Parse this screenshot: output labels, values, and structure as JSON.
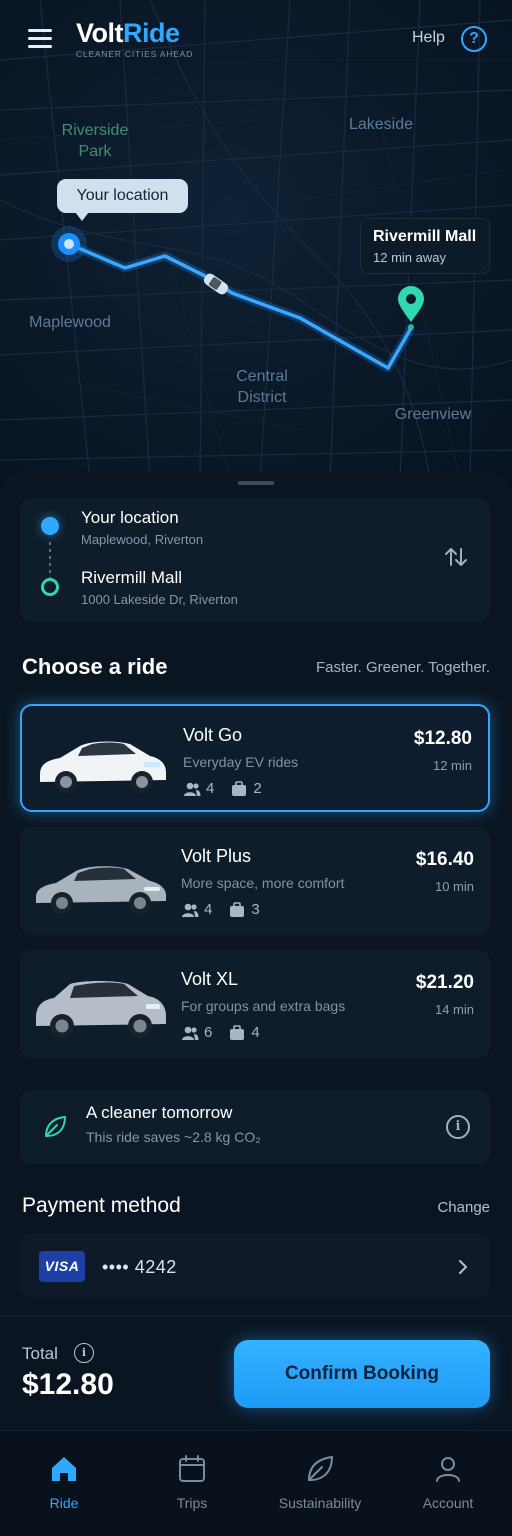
{
  "app": {
    "logo_primary": "Volt",
    "logo_accent": "Ride",
    "tagline": "CLEANER CITIES AHEAD",
    "help_label": "Help",
    "accent_color": "#2fa8ff",
    "eco_color": "#2fd7b3"
  },
  "map": {
    "labels": {
      "riverside_park": "Riverside\nPark",
      "lakeside": "Lakeside",
      "maplewood": "Maplewood",
      "central_district": "Central\nDistrict",
      "greenview": "Greenview"
    },
    "origin_bubble": "Your location",
    "destination_tooltip": {
      "title": "Rivermill Mall",
      "eta": "12 min away"
    }
  },
  "route": {
    "origin": {
      "title": "Your location",
      "address": "Maplewood, Riverton"
    },
    "destination": {
      "title": "Rivermill Mall",
      "address": "1000 Lakeside Dr, Riverton"
    }
  },
  "rides_section": {
    "title": "Choose a ride",
    "slogan": "Faster. Greener. Together.",
    "options": [
      {
        "name": "Volt Go",
        "description": "Everyday EV rides",
        "passengers": "4",
        "bags": "2",
        "price": "$12.80",
        "eta": "12 min",
        "car_color": "white",
        "selected": true
      },
      {
        "name": "Volt Plus",
        "description": "More space, more comfort",
        "passengers": "4",
        "bags": "3",
        "price": "$16.40",
        "eta": "10 min",
        "car_color": "silver",
        "selected": false
      },
      {
        "name": "Volt XL",
        "description": "For groups and extra bags",
        "passengers": "6",
        "bags": "4",
        "price": "$21.20",
        "eta": "14 min",
        "car_color": "silver-suv",
        "selected": false
      }
    ]
  },
  "eco": {
    "title": "A cleaner tomorrow",
    "subtitle": "This ride saves ~2.8 kg CO₂",
    "icon": "leaf-icon"
  },
  "payment": {
    "title": "Payment method",
    "change_label": "Change",
    "card_brand": "VISA",
    "card_masked": "•••• 4242"
  },
  "footer": {
    "total_label": "Total",
    "total_amount": "$12.80",
    "confirm_label": "Confirm Booking"
  },
  "tabs": [
    {
      "label": "Ride",
      "icon": "home-icon",
      "active": true
    },
    {
      "label": "Trips",
      "icon": "calendar-icon",
      "active": false
    },
    {
      "label": "Sustainability",
      "icon": "leaf-icon",
      "active": false
    },
    {
      "label": "Account",
      "icon": "person-icon",
      "active": false
    }
  ]
}
